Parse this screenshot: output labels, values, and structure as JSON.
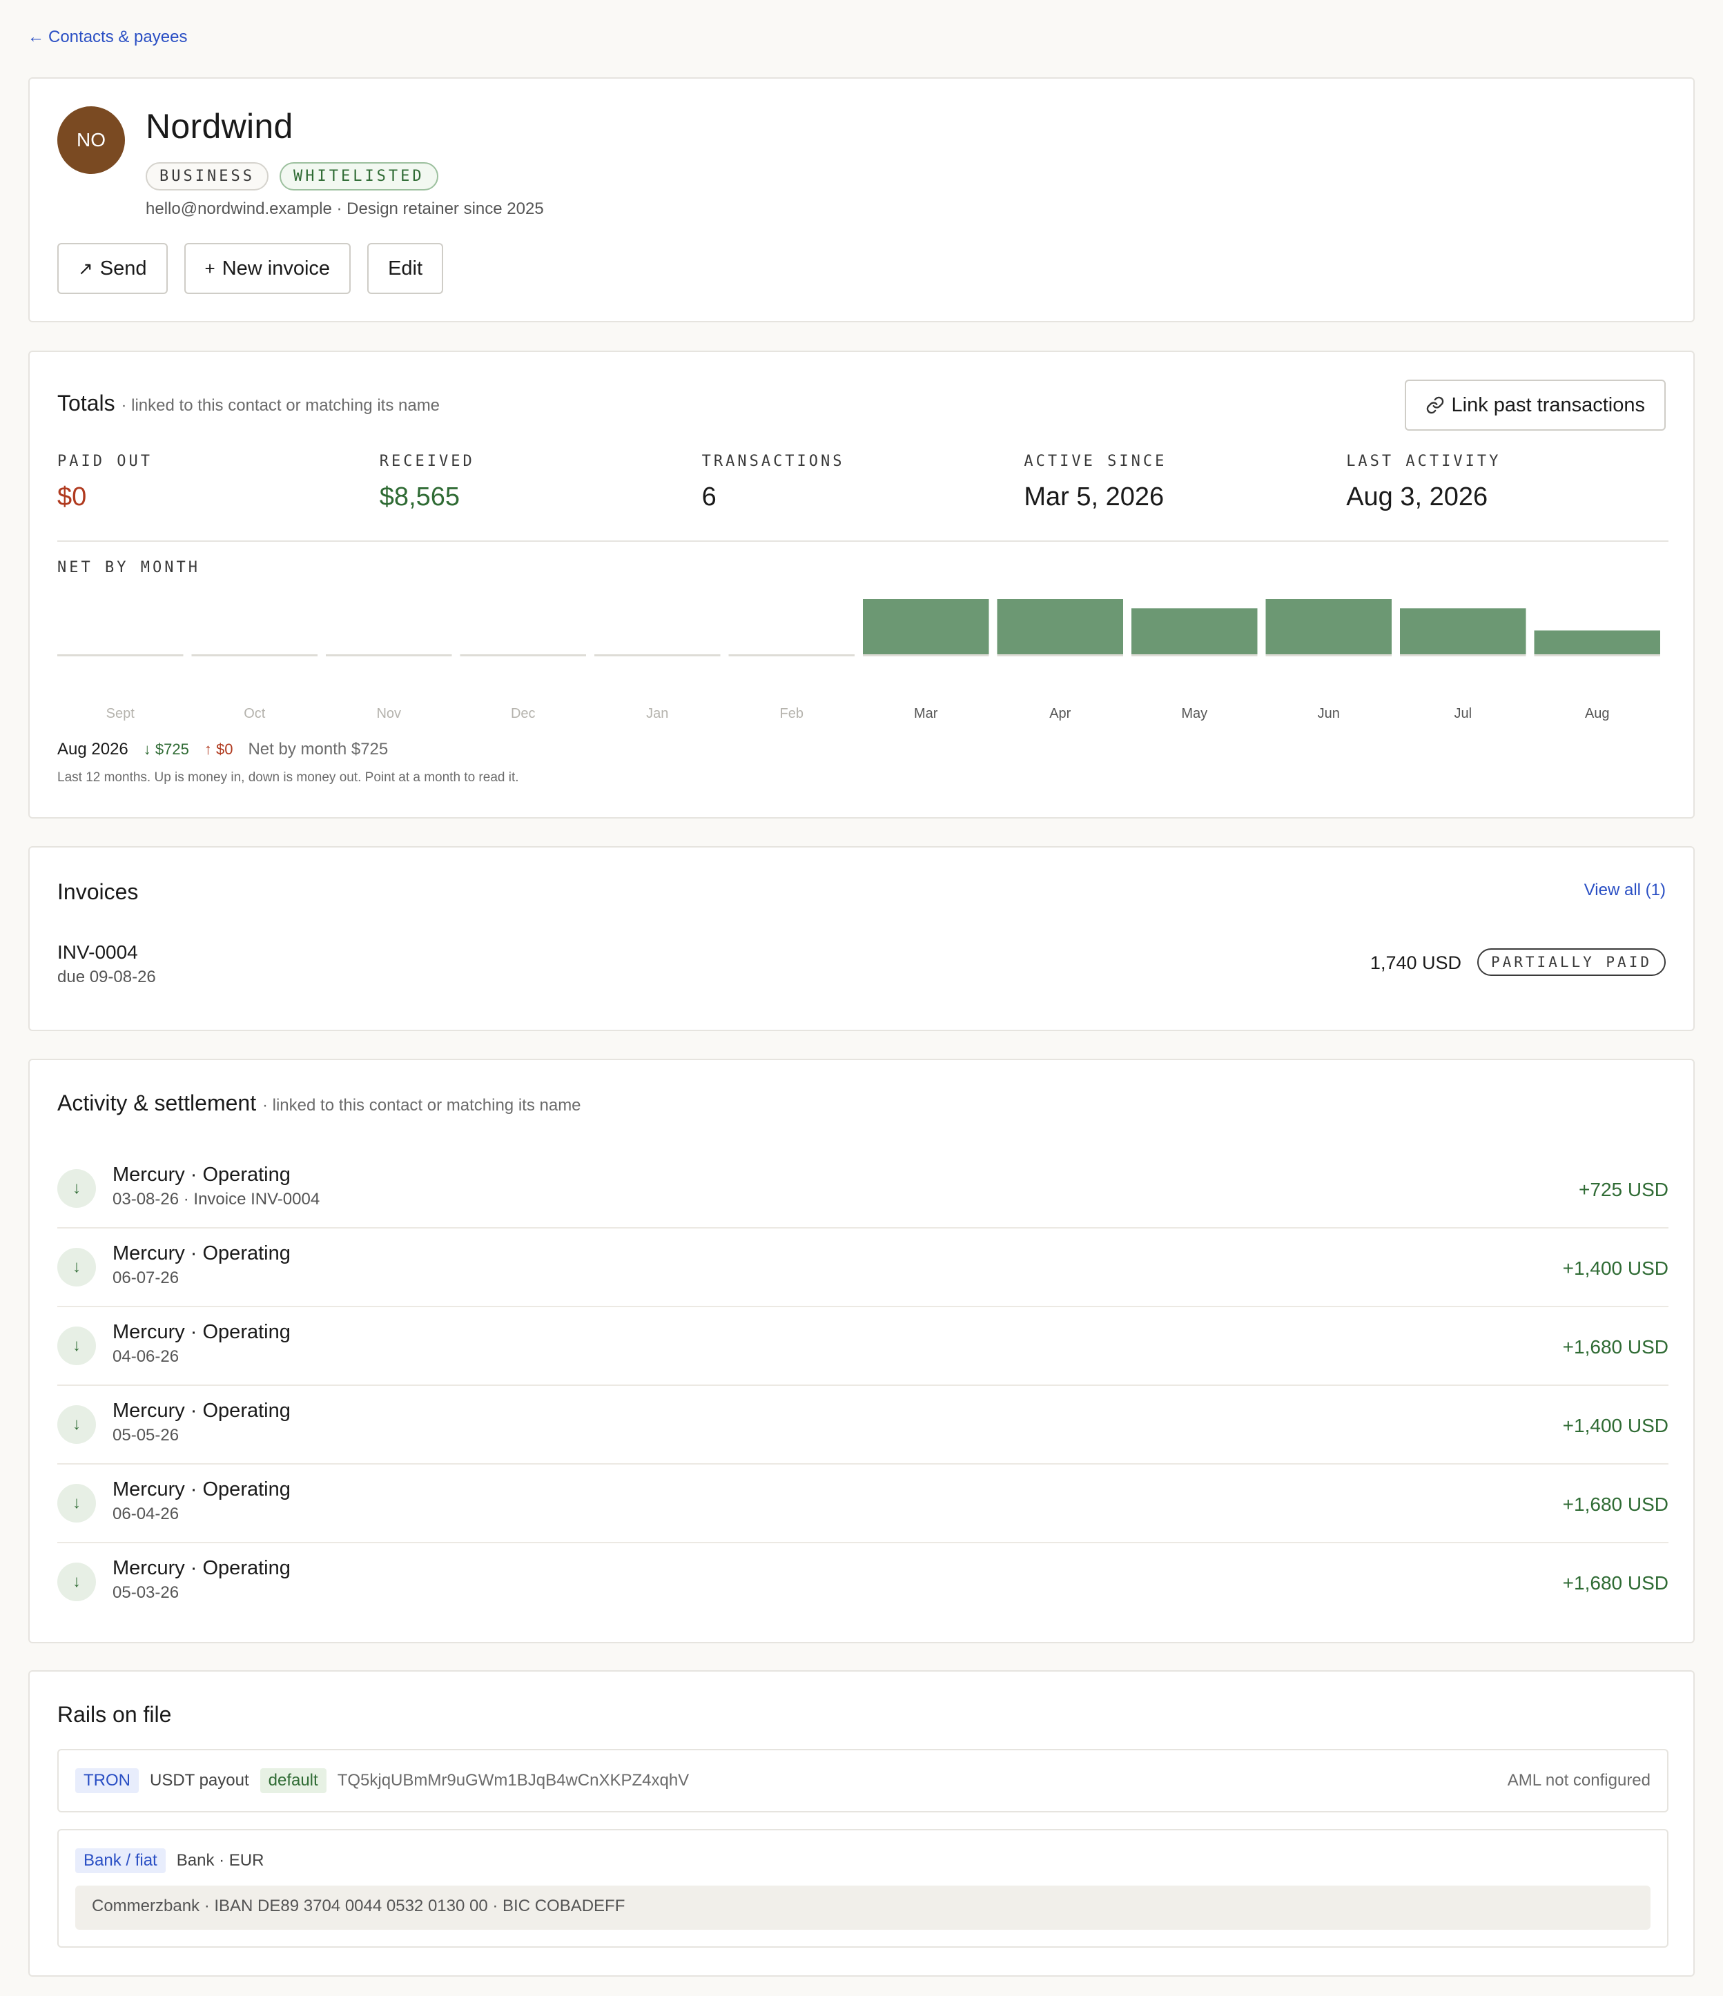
{
  "nav": {
    "back_label": "Contacts & payees"
  },
  "contact": {
    "initials": "NO",
    "name": "Nordwind",
    "badges": [
      "BUSINESS",
      "WHITELISTED"
    ],
    "description": "hello@nordwind.example · Design retainer since 2025",
    "actions": {
      "send": "Send",
      "new_invoice": "New invoice",
      "edit": "Edit"
    }
  },
  "totals": {
    "title": "Totals",
    "note": "· linked to this contact or matching its name",
    "link_button": "Link past transactions",
    "stats": [
      {
        "label": "PAID OUT",
        "value": "$0"
      },
      {
        "label": "RECEIVED",
        "value": "$8,565"
      },
      {
        "label": "TRANSACTIONS",
        "value": "6"
      },
      {
        "label": "ACTIVE SINCE",
        "value": "Mar 5, 2026"
      },
      {
        "label": "LAST ACTIVITY",
        "value": "Aug 3, 2026"
      }
    ],
    "chart_label": "NET BY MONTH",
    "footer": {
      "month": "Aug 2026",
      "in": "$725",
      "out": "$0",
      "net": "Net by month $725"
    },
    "chart_note": "Last 12 months. Up is money in, down is money out. Point at a month to read it."
  },
  "chart_data": {
    "type": "bar",
    "categories": [
      "Sept",
      "Oct",
      "Nov",
      "Dec",
      "Jan",
      "Feb",
      "Mar",
      "Apr",
      "May",
      "Jun",
      "Jul",
      "Aug"
    ],
    "values": [
      0,
      0,
      0,
      0,
      0,
      0,
      1680,
      1680,
      1400,
      1680,
      1400,
      725
    ],
    "ylim": [
      0,
      1680
    ],
    "colors": {
      "positive": "#6c9873",
      "baseline": "#dedcd6"
    }
  },
  "invoices": {
    "title": "Invoices",
    "view_all": "View all (1)",
    "items": [
      {
        "id": "INV-0004",
        "due": "due 09-08-26",
        "amount": "1,740 USD",
        "status": "PARTIALLY PAID"
      }
    ]
  },
  "activity": {
    "title": "Activity & settlement",
    "note": "· linked to this contact or matching its name",
    "items": [
      {
        "title": "Mercury · Operating",
        "sub": "03-08-26 · Invoice INV-0004",
        "amount": "+725 USD"
      },
      {
        "title": "Mercury · Operating",
        "sub": "06-07-26",
        "amount": "+1,400 USD"
      },
      {
        "title": "Mercury · Operating",
        "sub": "04-06-26",
        "amount": "+1,680 USD"
      },
      {
        "title": "Mercury · Operating",
        "sub": "05-05-26",
        "amount": "+1,400 USD"
      },
      {
        "title": "Mercury · Operating",
        "sub": "06-04-26",
        "amount": "+1,680 USD"
      },
      {
        "title": "Mercury · Operating",
        "sub": "05-03-26",
        "amount": "+1,680 USD"
      }
    ]
  },
  "rails": {
    "title": "Rails on file",
    "items": [
      {
        "network": "TRON",
        "kind": "USDT payout",
        "default": "default",
        "address": "TQ5kjqUBmMr9uGWm1BJqB4wCnXKPZ4xqhV",
        "aml": "AML not configured"
      },
      {
        "network": "Bank / fiat",
        "kind": "Bank · EUR",
        "detail": "Commerzbank · IBAN DE89 3704 0044 0532 0130 00 · BIC COBADEFF"
      }
    ]
  }
}
